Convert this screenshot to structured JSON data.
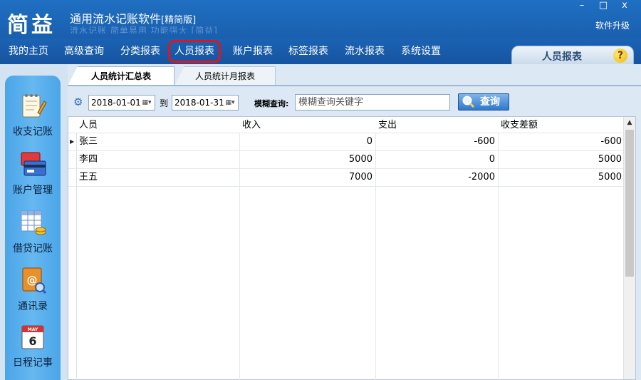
{
  "app": {
    "logo": "简益",
    "title": "通用流水记账软件",
    "edition": "[精简版]",
    "subtitle": "流水记账 简单易用 功能强大 [简益]",
    "upgrade_label": "软件升级"
  },
  "window_controls": {
    "minimize": "–",
    "maximize": "□",
    "close": "x"
  },
  "menu": {
    "items": [
      {
        "label": "我的主页"
      },
      {
        "label": "高级查询"
      },
      {
        "label": "分类报表"
      },
      {
        "label": "人员报表"
      },
      {
        "label": "账户报表"
      },
      {
        "label": "标签报表"
      },
      {
        "label": "流水报表"
      },
      {
        "label": "系统设置"
      }
    ],
    "active": "人员报表"
  },
  "page_tab": {
    "label": "人员报表",
    "help": "?"
  },
  "sidebar": {
    "items": [
      {
        "label": "收支记账",
        "icon": "notepad-pen-icon"
      },
      {
        "label": "账户管理",
        "icon": "credit-card-icon"
      },
      {
        "label": "借贷记账",
        "icon": "spreadsheet-coins-icon"
      },
      {
        "label": "通讯录",
        "icon": "address-book-icon"
      },
      {
        "label": "日程记事",
        "icon": "calendar-icon",
        "calendar_month": "MAY",
        "calendar_day": "6"
      }
    ]
  },
  "tabs": [
    {
      "label": "人员统计汇总表",
      "active": true
    },
    {
      "label": "人员统计月报表",
      "active": false
    }
  ],
  "toolbar": {
    "start_date": "2018-01-01",
    "to_label": "到",
    "end_date": "2018-01-31",
    "search_label": "模糊查询:",
    "search_placeholder": "模糊查询关键字",
    "query_label": "查询"
  },
  "table": {
    "columns": [
      "人员",
      "收入",
      "支出",
      "收支差额"
    ],
    "rows": [
      {
        "person": "张三",
        "income": "0",
        "expense": "-600",
        "balance": "-600",
        "selected": true
      },
      {
        "person": "李四",
        "income": "5000",
        "expense": "0",
        "balance": "5000",
        "selected": false
      },
      {
        "person": "王五",
        "income": "7000",
        "expense": "-2000",
        "balance": "5000",
        "selected": false
      }
    ]
  }
}
